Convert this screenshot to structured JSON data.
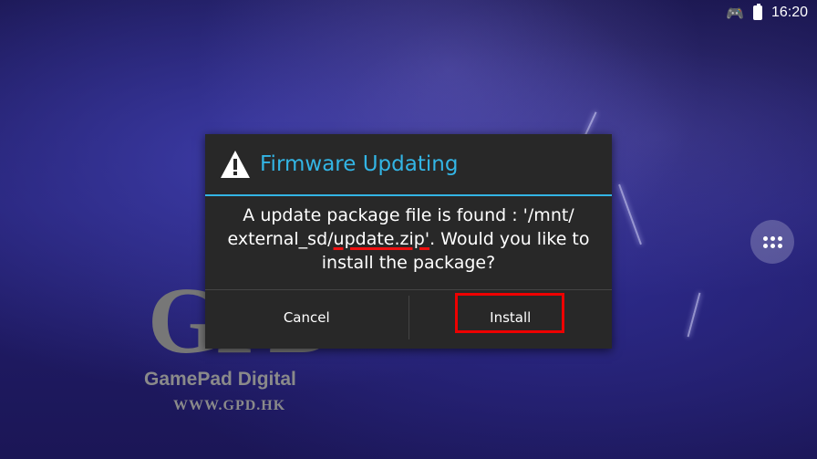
{
  "status_bar": {
    "time": "16:20",
    "icons": [
      "gamepad-icon",
      "battery-icon"
    ]
  },
  "logo": {
    "mark": "GPD",
    "name": "GamePad Digital",
    "url": "WWW.GPD.HK"
  },
  "dialog": {
    "title": "Firmware Updating",
    "icon": "warning-icon",
    "message_before": "A update package file is found : '/mnt/ external_sd/",
    "message_highlight": "update.zip'",
    "message_after": ". Would you like to install the package?",
    "buttons": {
      "cancel": "Cancel",
      "install": "Install"
    }
  },
  "colors": {
    "accent": "#33b5e5",
    "highlight": "#e00000",
    "dialog_bg": "#282828"
  },
  "launcher": {
    "icon": "apps-grid-icon"
  }
}
